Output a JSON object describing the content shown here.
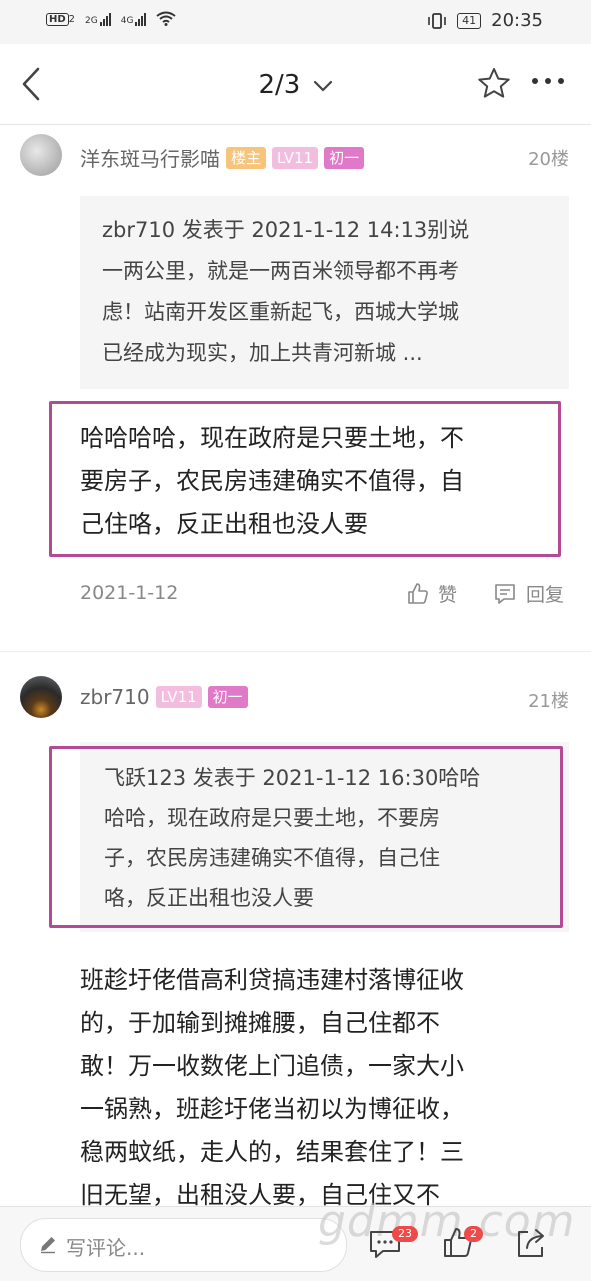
{
  "status_bar": {
    "hd": "HD",
    "sim1": "2",
    "net1": "2G",
    "net2": "4G",
    "battery": "41",
    "time": "20:35"
  },
  "nav": {
    "page_indicator": "2/3",
    "icons": [
      "back-arrow-icon",
      "chevron-down-icon",
      "star-icon",
      "more-icon"
    ]
  },
  "posts": [
    {
      "username": "洋东斑马行影喵",
      "badges": [
        "楼主",
        "LV11",
        "初一"
      ],
      "floor": "20楼",
      "quote": [
        "zbr710 发表于 2021-1-12 14:13别说",
        "一两公里，就是一两百米领导都不再考",
        "虑！站南开发区重新起飞，西城大学城",
        "已经成为现实，加上共青河新城 ..."
      ],
      "body": [
        "哈哈哈哈，现在政府是只要土地，不",
        "要房子，农民房违建确实不值得，自",
        "己住咯，反正出租也没人要"
      ],
      "date": "2021-1-12",
      "like_label": "赞",
      "reply_label": "回复"
    },
    {
      "username": "zbr710",
      "badges": [
        "LV11",
        "初一"
      ],
      "floor": "21楼",
      "quote": [
        "飞跃123 发表于 2021-1-12 16:30哈哈",
        "哈哈，现在政府是只要土地，不要房",
        "子，农民房违建确实不值得，自己住",
        "咯，反正出租也没人要"
      ],
      "body": [
        "班趁圩佬借高利贷搞违建村落博征收",
        "的，于加输到摊摊腰，自己住都不",
        "敢！万一收数佬上门追债，一家大小",
        "一锅熟，班趁圩佬当初以为博征收，",
        "稳两蚊纸，走人的，结果套住了！三",
        "旧无望，出租没人要，自己住又不"
      ]
    }
  ],
  "bottom_bar": {
    "placeholder": "写评论...",
    "comment_count": "23",
    "like_count": "2",
    "watermark": "gdmm.com"
  },
  "colors": {
    "highlight_border": "#b24a95",
    "badge_host": "#f6c47a",
    "badge_level": "#f3bde0",
    "badge_rank": "#df79c8",
    "count_badge": "#ef4a4a"
  }
}
